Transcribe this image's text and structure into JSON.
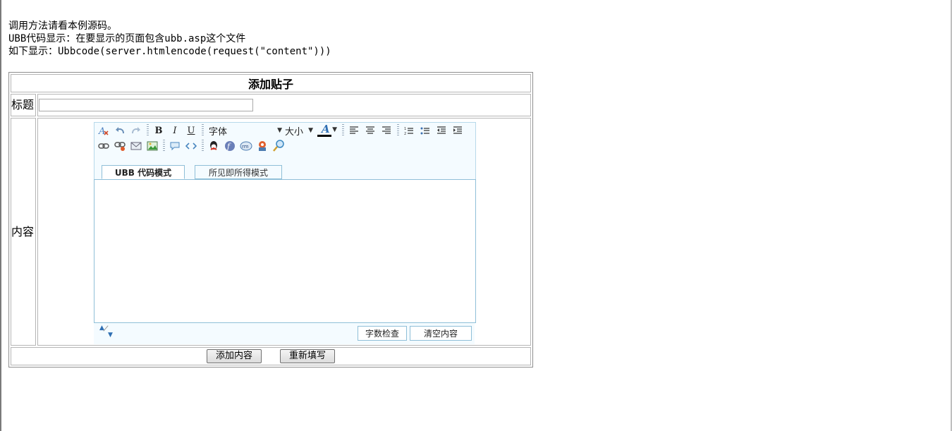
{
  "intro": {
    "line1": "调用方法请看本例源码。",
    "line2": "UBB代码显示：在要显示的页面包含ubb.asp这个文件",
    "line3": "如下显示：Ubbcode(server.htmlencode(request(\"content\")))"
  },
  "form": {
    "heading": "添加贴子",
    "title_label": "标题",
    "title_value": "",
    "content_label": "内容",
    "submit_label": "添加内容",
    "reset_label": "重新填写"
  },
  "editor": {
    "font_label": "字体",
    "size_label": "大小",
    "tabs": [
      "UBB 代码模式",
      "所见即所得模式"
    ],
    "count_label": "字数检查",
    "clear_label": "清空内容",
    "text_color": "#000000"
  },
  "icons": {
    "row1": [
      "remove-format-icon",
      "undo-icon",
      "redo-icon",
      "bold-icon",
      "italic-icon",
      "underline-icon",
      "font-select",
      "size-select",
      "font-color-icon",
      "align-left-icon",
      "align-center-icon",
      "align-right-icon",
      "ordered-list-icon",
      "unordered-list-icon",
      "outdent-icon",
      "indent-icon"
    ],
    "row2": [
      "link-icon",
      "unlink-icon",
      "email-icon",
      "image-icon",
      "quote-icon",
      "code-icon",
      "qq-icon",
      "flash-icon",
      "realmedia-icon",
      "media-player-icon",
      "search-icon"
    ]
  }
}
